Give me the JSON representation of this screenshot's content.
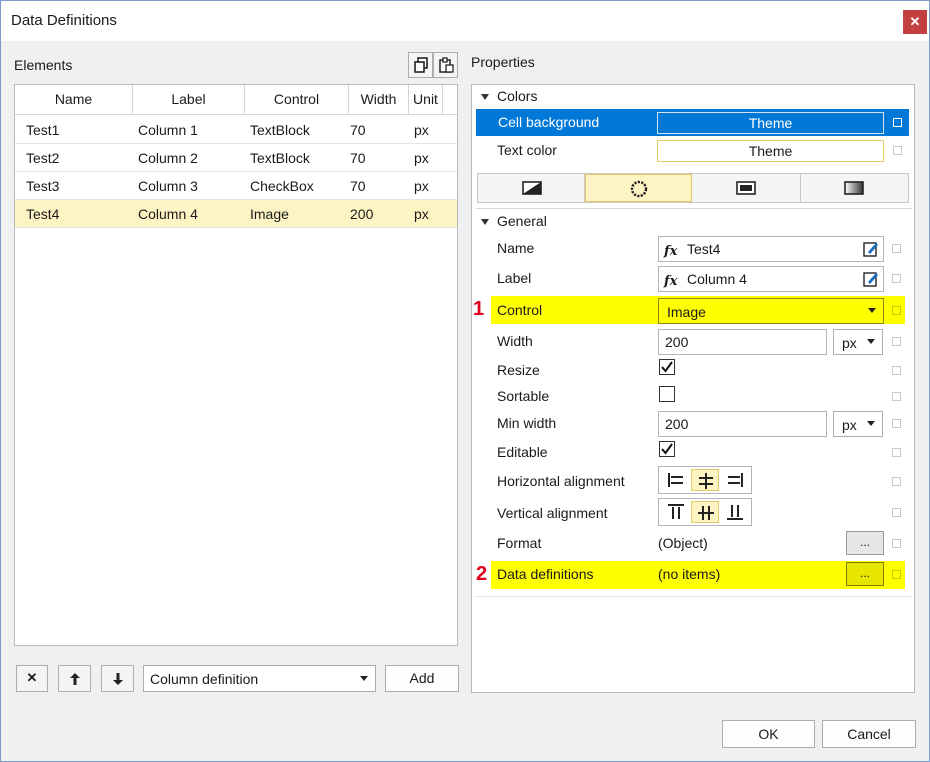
{
  "window": {
    "title": "Data Definitions",
    "close_glyph": "✕"
  },
  "elements": {
    "label": "Elements",
    "columns": [
      "Name",
      "Label",
      "Control",
      "Width",
      "Unit"
    ],
    "rows": [
      {
        "name": "Test1",
        "label": "Column 1",
        "control": "TextBlock",
        "width": "70",
        "unit": "px",
        "selected": false
      },
      {
        "name": "Test2",
        "label": "Column 2",
        "control": "TextBlock",
        "width": "70",
        "unit": "px",
        "selected": false
      },
      {
        "name": "Test3",
        "label": "Column 3",
        "control": "CheckBox",
        "width": "70",
        "unit": "px",
        "selected": false
      },
      {
        "name": "Test4",
        "label": "Column 4",
        "control": "Image",
        "width": "200",
        "unit": "px",
        "selected": true
      }
    ],
    "toolbar_icons": [
      "copy-icon",
      "paste-icon"
    ],
    "bottom": {
      "delete_glyph": "✕",
      "up_glyph": "🡑",
      "down_glyph": "🡓",
      "type_value": "Column definition",
      "add_label": "Add"
    }
  },
  "properties": {
    "label": "Properties",
    "colors": {
      "header": "Colors",
      "cell_background": {
        "label": "Cell background",
        "value": "Theme"
      },
      "text_color": {
        "label": "Text color",
        "value": "Theme"
      },
      "tabs": [
        "solid-fill-icon",
        "palette-ring-icon",
        "rectangle-icon",
        "gradient-icon"
      ]
    },
    "general": {
      "header": "General",
      "name": {
        "label": "Name",
        "value": "Test4"
      },
      "label_row": {
        "label": "Label",
        "value": "Column 4"
      },
      "control": {
        "label": "Control",
        "value": "Image",
        "marker": "1"
      },
      "width": {
        "label": "Width",
        "value": "200",
        "unit": "px"
      },
      "resize": {
        "label": "Resize",
        "checked": true
      },
      "sortable": {
        "label": "Sortable",
        "checked": false
      },
      "min_width": {
        "label": "Min width",
        "value": "200",
        "unit": "px"
      },
      "editable": {
        "label": "Editable",
        "checked": true
      },
      "h_align": {
        "label": "Horizontal alignment"
      },
      "v_align": {
        "label": "Vertical alignment"
      },
      "format": {
        "label": "Format",
        "value": "(Object)",
        "button": "..."
      },
      "data_definitions": {
        "label": "Data definitions",
        "value": "(no items)",
        "button": "...",
        "marker": "2"
      }
    },
    "fx": "fx"
  },
  "footer": {
    "ok_label": "OK",
    "cancel_label": "Cancel"
  },
  "colors": {
    "selection_blue": "#0078d7",
    "highlight_yellow": "#ffff00",
    "selected_row": "#fdf4c4",
    "marker_red": "#e0001a"
  }
}
